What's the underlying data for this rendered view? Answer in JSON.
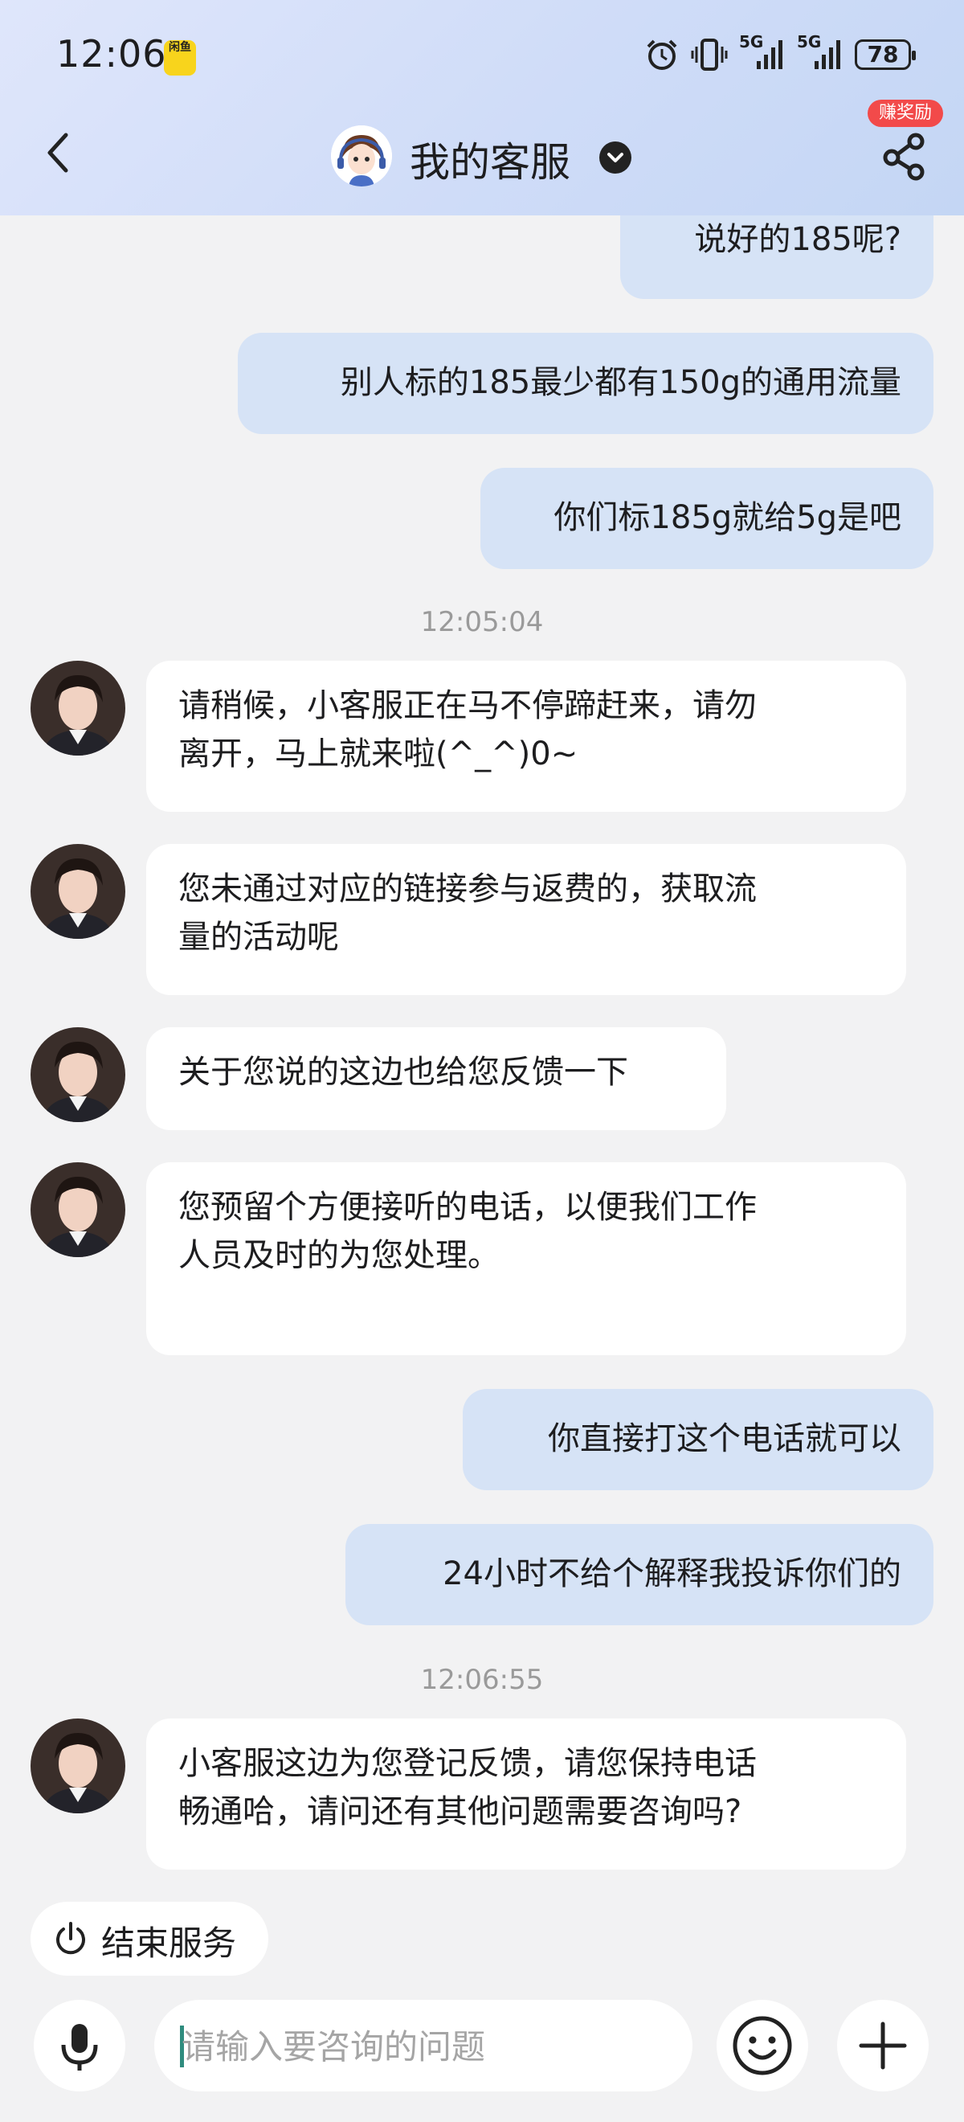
{
  "status_bar": {
    "time": "12:06",
    "app_badge": "闲鱼",
    "network_1": "5G",
    "network_2": "5G",
    "battery": "78"
  },
  "nav": {
    "title": "我的客服",
    "reward_badge": "赚奖励"
  },
  "messages": [
    {
      "type": "out",
      "text": "说好的185呢?"
    },
    {
      "type": "out",
      "text": "别人标的185最少都有150g的通用流量"
    },
    {
      "type": "out",
      "text": "你们标185g就给5g是吧"
    },
    {
      "type": "time",
      "text": "12:05:04"
    },
    {
      "type": "in",
      "lines": [
        "请稍候，小客服正在马不停蹄赶来，请勿",
        "离开，马上就来啦(^_^)0~"
      ]
    },
    {
      "type": "in",
      "lines": [
        "您未通过对应的链接参与返费的，获取流",
        "量的活动呢"
      ]
    },
    {
      "type": "in",
      "lines": [
        "关于您说的这边也给您反馈一下"
      ]
    },
    {
      "type": "in",
      "lines": [
        "您预留个方便接听的电话，以便我们工作",
        "人员及时的为您处理。"
      ]
    },
    {
      "type": "out",
      "text": "你直接打这个电话就可以"
    },
    {
      "type": "out",
      "text": "24小时不给个解释我投诉你们的"
    },
    {
      "type": "time",
      "text": "12:06:55"
    },
    {
      "type": "in",
      "lines": [
        "小客服这边为您登记反馈，请您保持电话",
        "畅通哈，请问还有其他问题需要咨询吗?"
      ]
    }
  ],
  "end_service": {
    "label": "结束服务"
  },
  "input": {
    "placeholder": "请输入要咨询的问题"
  },
  "colors": {
    "outgoing_bubble": "#d6e3f6",
    "incoming_bubble": "#ffffff",
    "background": "#f2f2f3",
    "reward": "#f24a4a"
  }
}
